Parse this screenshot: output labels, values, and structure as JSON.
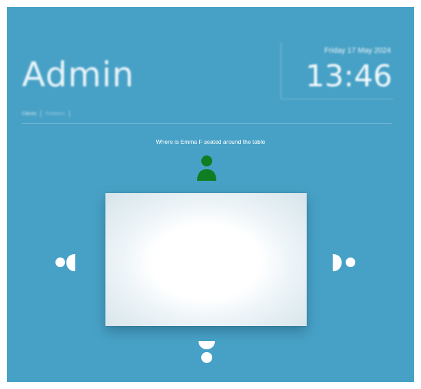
{
  "header": {
    "title": "Admin",
    "date": "Friday 17 May 2024",
    "time": "13:46"
  },
  "tabs": [
    {
      "label": "Clients"
    },
    {
      "label": "Positions"
    }
  ],
  "question": "Where is Emma F seated around the table",
  "seats": {
    "top": {
      "icon": "person-icon",
      "color": "#0f7d22",
      "state": "highlighted"
    },
    "left": {
      "icon": "seat-left-icon",
      "color": "#ffffff"
    },
    "right": {
      "icon": "seat-right-icon",
      "color": "#ffffff"
    },
    "bottom": {
      "icon": "seat-bottom-icon",
      "color": "#ffffff"
    }
  },
  "colors": {
    "background": "#47a1c6",
    "highlight": "#0f7d22",
    "table": "#ffffff"
  }
}
